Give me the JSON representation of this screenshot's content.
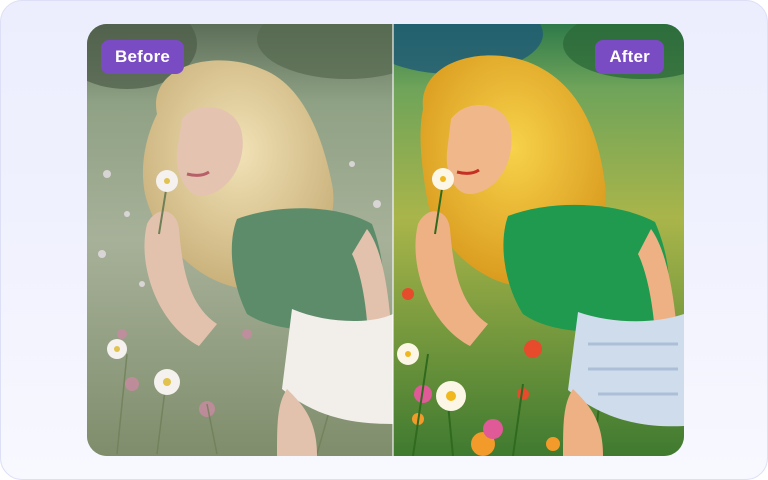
{
  "comparison": {
    "before_label": "Before",
    "after_label": "After",
    "before_image": "photo-woman-smelling-daisy-flower-field",
    "after_image": "painted-woman-smelling-daisy-flower-field"
  },
  "colors": {
    "badge": "#7a4cc3",
    "badge_text": "#ffffff",
    "frame_background": "#eceefe"
  }
}
